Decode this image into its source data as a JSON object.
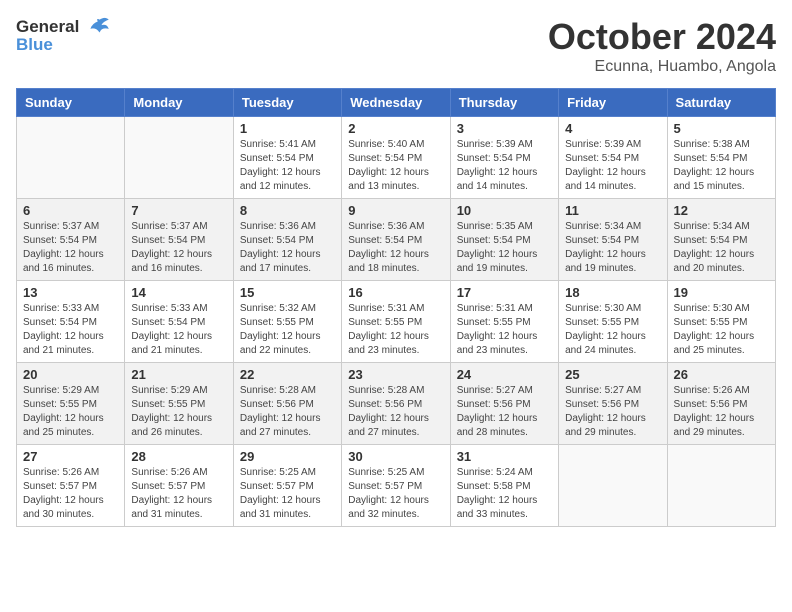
{
  "header": {
    "logo": {
      "general": "General",
      "blue": "Blue"
    },
    "title": "October 2024",
    "subtitle": "Ecunna, Huambo, Angola"
  },
  "calendar": {
    "days_of_week": [
      "Sunday",
      "Monday",
      "Tuesday",
      "Wednesday",
      "Thursday",
      "Friday",
      "Saturday"
    ],
    "weeks": [
      [
        {
          "day": "",
          "info": ""
        },
        {
          "day": "",
          "info": ""
        },
        {
          "day": "1",
          "info": "Sunrise: 5:41 AM\nSunset: 5:54 PM\nDaylight: 12 hours\nand 12 minutes."
        },
        {
          "day": "2",
          "info": "Sunrise: 5:40 AM\nSunset: 5:54 PM\nDaylight: 12 hours\nand 13 minutes."
        },
        {
          "day": "3",
          "info": "Sunrise: 5:39 AM\nSunset: 5:54 PM\nDaylight: 12 hours\nand 14 minutes."
        },
        {
          "day": "4",
          "info": "Sunrise: 5:39 AM\nSunset: 5:54 PM\nDaylight: 12 hours\nand 14 minutes."
        },
        {
          "day": "5",
          "info": "Sunrise: 5:38 AM\nSunset: 5:54 PM\nDaylight: 12 hours\nand 15 minutes."
        }
      ],
      [
        {
          "day": "6",
          "info": "Sunrise: 5:37 AM\nSunset: 5:54 PM\nDaylight: 12 hours\nand 16 minutes."
        },
        {
          "day": "7",
          "info": "Sunrise: 5:37 AM\nSunset: 5:54 PM\nDaylight: 12 hours\nand 16 minutes."
        },
        {
          "day": "8",
          "info": "Sunrise: 5:36 AM\nSunset: 5:54 PM\nDaylight: 12 hours\nand 17 minutes."
        },
        {
          "day": "9",
          "info": "Sunrise: 5:36 AM\nSunset: 5:54 PM\nDaylight: 12 hours\nand 18 minutes."
        },
        {
          "day": "10",
          "info": "Sunrise: 5:35 AM\nSunset: 5:54 PM\nDaylight: 12 hours\nand 19 minutes."
        },
        {
          "day": "11",
          "info": "Sunrise: 5:34 AM\nSunset: 5:54 PM\nDaylight: 12 hours\nand 19 minutes."
        },
        {
          "day": "12",
          "info": "Sunrise: 5:34 AM\nSunset: 5:54 PM\nDaylight: 12 hours\nand 20 minutes."
        }
      ],
      [
        {
          "day": "13",
          "info": "Sunrise: 5:33 AM\nSunset: 5:54 PM\nDaylight: 12 hours\nand 21 minutes."
        },
        {
          "day": "14",
          "info": "Sunrise: 5:33 AM\nSunset: 5:54 PM\nDaylight: 12 hours\nand 21 minutes."
        },
        {
          "day": "15",
          "info": "Sunrise: 5:32 AM\nSunset: 5:55 PM\nDaylight: 12 hours\nand 22 minutes."
        },
        {
          "day": "16",
          "info": "Sunrise: 5:31 AM\nSunset: 5:55 PM\nDaylight: 12 hours\nand 23 minutes."
        },
        {
          "day": "17",
          "info": "Sunrise: 5:31 AM\nSunset: 5:55 PM\nDaylight: 12 hours\nand 23 minutes."
        },
        {
          "day": "18",
          "info": "Sunrise: 5:30 AM\nSunset: 5:55 PM\nDaylight: 12 hours\nand 24 minutes."
        },
        {
          "day": "19",
          "info": "Sunrise: 5:30 AM\nSunset: 5:55 PM\nDaylight: 12 hours\nand 25 minutes."
        }
      ],
      [
        {
          "day": "20",
          "info": "Sunrise: 5:29 AM\nSunset: 5:55 PM\nDaylight: 12 hours\nand 25 minutes."
        },
        {
          "day": "21",
          "info": "Sunrise: 5:29 AM\nSunset: 5:55 PM\nDaylight: 12 hours\nand 26 minutes."
        },
        {
          "day": "22",
          "info": "Sunrise: 5:28 AM\nSunset: 5:56 PM\nDaylight: 12 hours\nand 27 minutes."
        },
        {
          "day": "23",
          "info": "Sunrise: 5:28 AM\nSunset: 5:56 PM\nDaylight: 12 hours\nand 27 minutes."
        },
        {
          "day": "24",
          "info": "Sunrise: 5:27 AM\nSunset: 5:56 PM\nDaylight: 12 hours\nand 28 minutes."
        },
        {
          "day": "25",
          "info": "Sunrise: 5:27 AM\nSunset: 5:56 PM\nDaylight: 12 hours\nand 29 minutes."
        },
        {
          "day": "26",
          "info": "Sunrise: 5:26 AM\nSunset: 5:56 PM\nDaylight: 12 hours\nand 29 minutes."
        }
      ],
      [
        {
          "day": "27",
          "info": "Sunrise: 5:26 AM\nSunset: 5:57 PM\nDaylight: 12 hours\nand 30 minutes."
        },
        {
          "day": "28",
          "info": "Sunrise: 5:26 AM\nSunset: 5:57 PM\nDaylight: 12 hours\nand 31 minutes."
        },
        {
          "day": "29",
          "info": "Sunrise: 5:25 AM\nSunset: 5:57 PM\nDaylight: 12 hours\nand 31 minutes."
        },
        {
          "day": "30",
          "info": "Sunrise: 5:25 AM\nSunset: 5:57 PM\nDaylight: 12 hours\nand 32 minutes."
        },
        {
          "day": "31",
          "info": "Sunrise: 5:24 AM\nSunset: 5:58 PM\nDaylight: 12 hours\nand 33 minutes."
        },
        {
          "day": "",
          "info": ""
        },
        {
          "day": "",
          "info": ""
        }
      ]
    ]
  }
}
